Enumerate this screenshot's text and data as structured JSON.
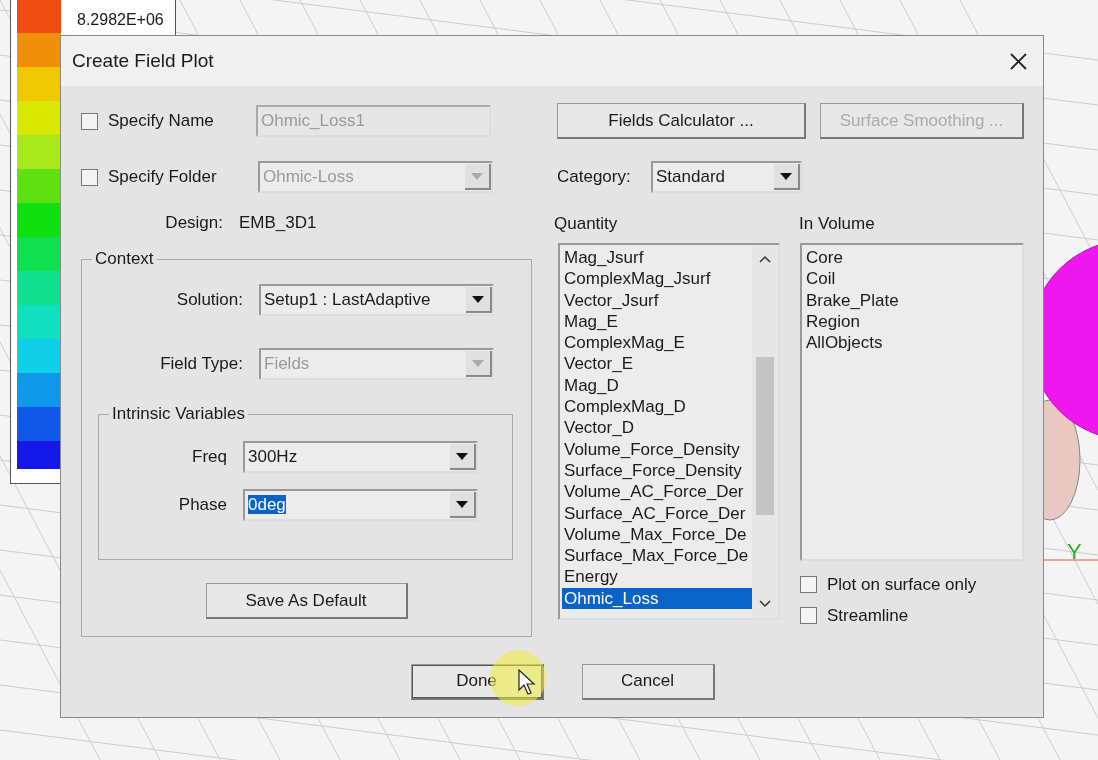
{
  "legend": {
    "value": "8.2982E+06"
  },
  "viewport": {
    "axis_label": "Y"
  },
  "dialog": {
    "title": "Create Field Plot",
    "specify_name": {
      "label": "Specify Name",
      "checked": false,
      "value": "Ohmic_Loss1",
      "disabled": true
    },
    "specify_folder": {
      "label": "Specify Folder",
      "checked": false,
      "value": "Ohmic-Loss",
      "disabled": true
    },
    "design": {
      "label": "Design:",
      "value": "EMB_3D1"
    },
    "context": {
      "title": "Context",
      "solution": {
        "label": "Solution:",
        "value": "Setup1 : LastAdaptive",
        "disabled": false
      },
      "field_type": {
        "label": "Field Type:",
        "value": "Fields",
        "disabled": true
      },
      "intrinsic": {
        "title": "Intrinsic Variables",
        "fields": [
          {
            "label": "Freq",
            "value": "300Hz",
            "disabled": false,
            "text_selected": false
          },
          {
            "label": "Phase",
            "value": "0deg",
            "disabled": false,
            "text_selected": true
          }
        ]
      },
      "save_button": "Save As Default"
    },
    "fields_calculator": {
      "label": "Fields Calculator ...",
      "disabled": false
    },
    "surface_smoothing": {
      "label": "Surface Smoothing ...",
      "disabled": true
    },
    "category": {
      "label": "Category:",
      "value": "Standard",
      "disabled": false
    },
    "quantity": {
      "title": "Quantity",
      "items": [
        {
          "label": "Mag_Jsurf",
          "selected": false
        },
        {
          "label": "ComplexMag_Jsurf",
          "selected": false
        },
        {
          "label": "Vector_Jsurf",
          "selected": false
        },
        {
          "label": "Mag_E",
          "selected": false
        },
        {
          "label": "ComplexMag_E",
          "selected": false
        },
        {
          "label": "Vector_E",
          "selected": false
        },
        {
          "label": "Mag_D",
          "selected": false
        },
        {
          "label": "ComplexMag_D",
          "selected": false
        },
        {
          "label": "Vector_D",
          "selected": false
        },
        {
          "label": "Volume_Force_Density",
          "selected": false
        },
        {
          "label": "Surface_Force_Density",
          "selected": false
        },
        {
          "label": "Volume_AC_Force_Der",
          "selected": false
        },
        {
          "label": "Surface_AC_Force_Der",
          "selected": false
        },
        {
          "label": "Volume_Max_Force_De",
          "selected": false
        },
        {
          "label": "Surface_Max_Force_De",
          "selected": false
        },
        {
          "label": "Energy",
          "selected": false
        },
        {
          "label": "Ohmic_Loss",
          "selected": true
        }
      ]
    },
    "in_volume": {
      "title": "In Volume",
      "items": [
        {
          "label": "Core",
          "selected": false
        },
        {
          "label": "Coil",
          "selected": false
        },
        {
          "label": "Brake_Plate",
          "selected": false
        },
        {
          "label": "Region",
          "selected": false
        },
        {
          "label": "AllObjects",
          "selected": false
        }
      ]
    },
    "options": [
      {
        "label": "Plot on surface only",
        "checked": false
      },
      {
        "label": "Streamline",
        "checked": false
      }
    ],
    "buttons": [
      {
        "label": "Done",
        "focused": true
      },
      {
        "label": "Cancel",
        "focused": false
      }
    ]
  }
}
